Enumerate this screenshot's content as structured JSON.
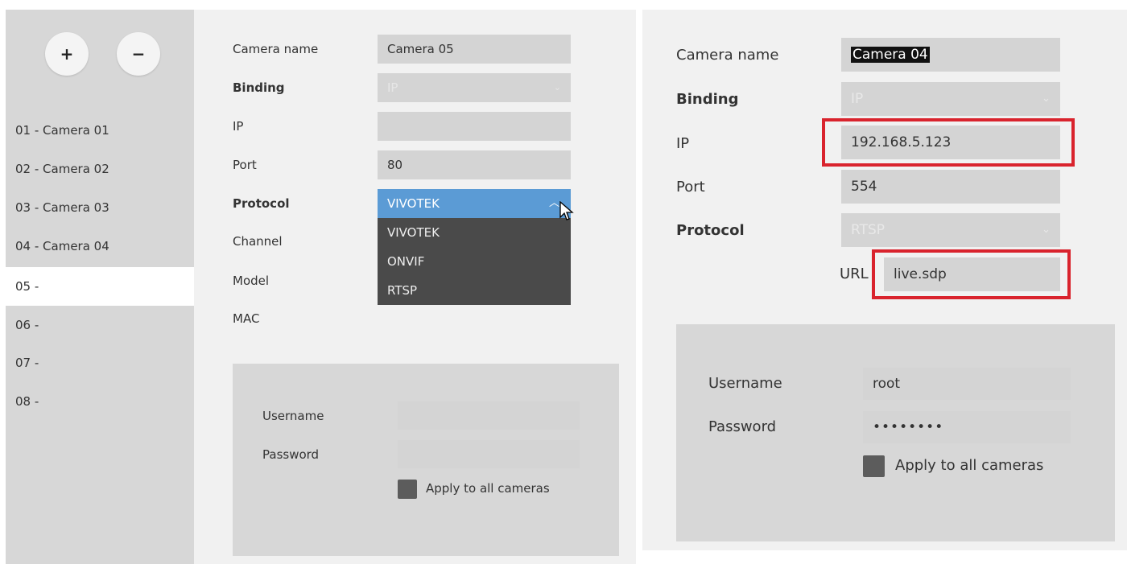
{
  "left": {
    "buttons": {
      "add": "+",
      "remove": "−"
    },
    "camera_list": [
      "01 - Camera 01",
      "02 - Camera 02",
      "03 - Camera 03",
      "04 - Camera 04",
      "05 -",
      "06 -",
      "07 -",
      "08 -"
    ],
    "selected_index": 4,
    "form": {
      "camera_name_label": "Camera name",
      "camera_name_value": "Camera 05",
      "binding_label": "Binding",
      "binding_value": "IP",
      "ip_label": "IP",
      "ip_value": "",
      "port_label": "Port",
      "port_value": "80",
      "protocol_label": "Protocol",
      "protocol_value": "VIVOTEK",
      "protocol_options": [
        "VIVOTEK",
        "ONVIF",
        "RTSP"
      ],
      "channel_label": "Channel",
      "model_label": "Model",
      "mac_label": "MAC"
    },
    "credentials": {
      "username_label": "Username",
      "username_value": "",
      "password_label": "Password",
      "password_value": "",
      "apply_label": "Apply to all cameras"
    }
  },
  "right": {
    "form": {
      "camera_name_label": "Camera name",
      "camera_name_value": "Camera 04",
      "binding_label": "Binding",
      "binding_value": "IP",
      "ip_label": "IP",
      "ip_value": "192.168.5.123",
      "port_label": "Port",
      "port_value": "554",
      "protocol_label": "Protocol",
      "protocol_value": "RTSP",
      "url_label": "URL",
      "url_value": "live.sdp"
    },
    "credentials": {
      "username_label": "Username",
      "username_value": "root",
      "password_label": "Password",
      "password_value": "••••••••",
      "apply_label": "Apply to all cameras"
    }
  },
  "colors": {
    "sidebar_bg": "#d7d7d7",
    "field_bg": "#d4d4d4",
    "dropdown_bg": "#4a4a4a",
    "dropdown_selected": "#5b9bd5",
    "highlight": "#d9232d"
  }
}
